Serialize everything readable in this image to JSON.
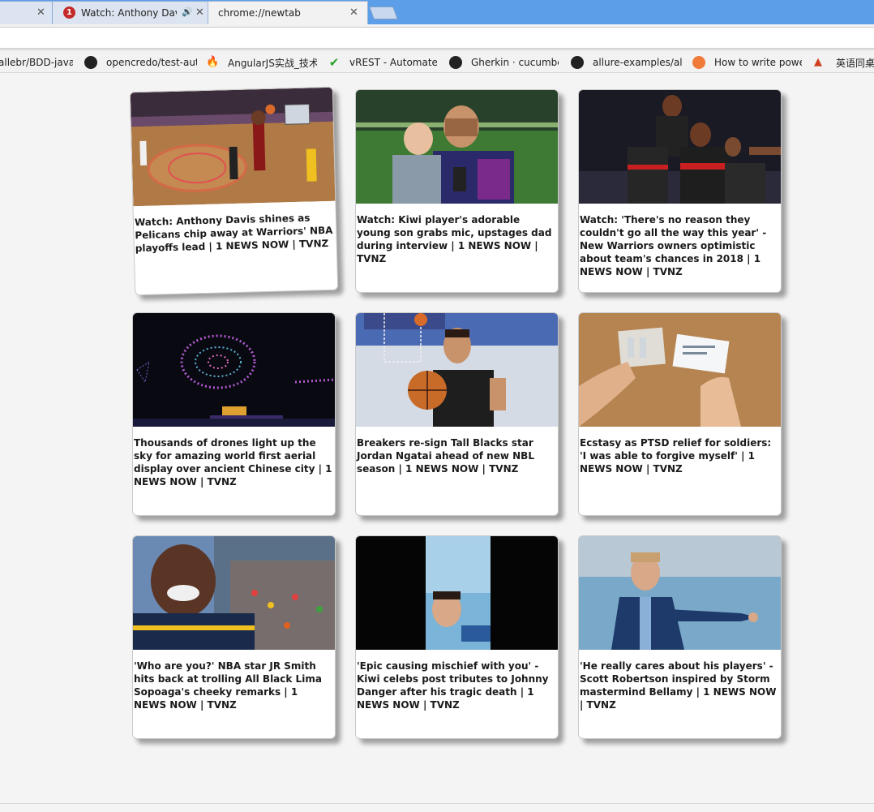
{
  "tabs": [
    {
      "title": "",
      "close": "✕"
    },
    {
      "title": "Watch: Anthony Davis shines as Pelicans",
      "badge": "1",
      "close": "✕",
      "speaker": "🔊"
    },
    {
      "title": "chrome://newtab",
      "close": "✕"
    }
  ],
  "bookmarks": [
    {
      "label": "allebr/BDD-java-c",
      "icon": "none"
    },
    {
      "label": "opencredo/test-auto",
      "icon": "github-icon"
    },
    {
      "label": "AngularJS实战_技术",
      "icon": "fire-icon"
    },
    {
      "label": "vREST - Automated",
      "icon": "check-icon"
    },
    {
      "label": "Gherkin · cucumber/",
      "icon": "github-icon"
    },
    {
      "label": "allure-examples/allu",
      "icon": "github-icon"
    },
    {
      "label": "How to write powerf",
      "icon": "orange-icon"
    },
    {
      "label": "英语同桌",
      "icon": "multi-icon"
    }
  ],
  "cards": [
    {
      "caption": "Watch: Anthony Davis shines as Pelicans chip away at Warriors' NBA playoffs lead | 1 NEWS NOW | TVNZ",
      "image": "basketball-dunk",
      "tilted": true
    },
    {
      "caption": "Watch: Kiwi player's adorable young son grabs mic, upstages dad during interview | 1 NEWS NOW | TVNZ",
      "image": "player-with-child"
    },
    {
      "caption": "Watch: 'There's no reason they couldn't go all the way this year' - New Warriors owners optimistic about team's chances in 2018 | 1 NEWS NOW | TVNZ",
      "image": "rugby-celebration"
    },
    {
      "caption": "Thousands of drones light up the sky for amazing world first aerial display over ancient Chinese city | 1 NEWS NOW | TVNZ",
      "image": "drone-display"
    },
    {
      "caption": "Breakers re-sign Tall Blacks star Jordan Ngatai ahead of new NBL season | 1 NEWS NOW | TVNZ",
      "image": "basketball-player"
    },
    {
      "caption": "Ecstasy as PTSD relief for soldiers: 'I was able to forgive myself' | 1 NEWS NOW | TVNZ",
      "image": "pill-packets"
    },
    {
      "caption": "'Who are you?' NBA star JR Smith hits back at trolling All Black Lima Sopoaga's cheeky remarks | 1 NEWS NOW | TVNZ",
      "image": "laughing-player"
    },
    {
      "caption": "'Epic causing mischief with you' - Kiwi celebs post tributes to Johnny Danger after his tragic death | 1 NEWS NOW | TVNZ",
      "image": "selfie-video"
    },
    {
      "caption": "'He really cares about his players' - Scott Robertson inspired by Storm mastermind Bellamy | 1 NEWS NOW | TVNZ",
      "image": "coach-pointing"
    }
  ]
}
